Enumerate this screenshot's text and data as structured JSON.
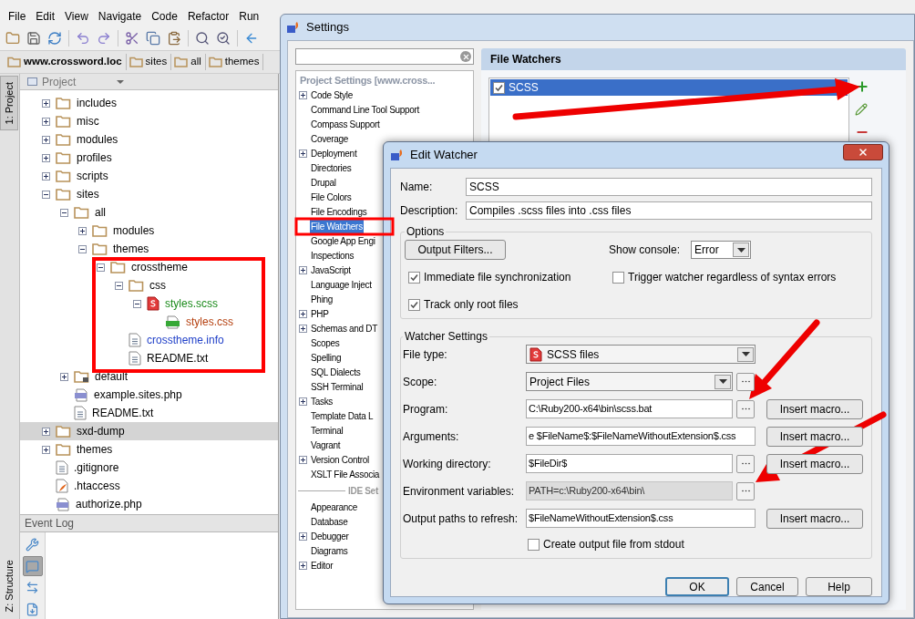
{
  "menu": [
    "File",
    "Edit",
    "View",
    "Navigate",
    "Code",
    "Refactor",
    "Run"
  ],
  "breadcrumb": [
    {
      "label": "www.crossword.loc",
      "kind": "root"
    },
    {
      "label": "sites",
      "kind": "folder"
    },
    {
      "label": "all",
      "kind": "folder"
    },
    {
      "label": "themes",
      "kind": "folder"
    }
  ],
  "side_tabs": {
    "top": [
      {
        "label": "1: Project",
        "selected": true
      }
    ],
    "bottom": [
      {
        "label": "Z: Structure",
        "selected": false
      }
    ]
  },
  "project_panel": {
    "title": "Project"
  },
  "tree": [
    {
      "label": "includes",
      "kind": "folder",
      "expanded": false,
      "selected": false
    },
    {
      "label": "misc",
      "kind": "folder",
      "expanded": false,
      "selected": false
    },
    {
      "label": "modules",
      "kind": "folder",
      "expanded": false,
      "selected": false
    },
    {
      "label": "profiles",
      "kind": "folder",
      "expanded": false,
      "selected": false
    },
    {
      "label": "scripts",
      "kind": "folder",
      "expanded": false,
      "selected": false
    },
    {
      "label": "sites",
      "kind": "folder",
      "expanded": true,
      "selected": false,
      "children": [
        {
          "label": "all",
          "kind": "folder",
          "expanded": true,
          "selected": false,
          "children": [
            {
              "label": "modules",
              "kind": "folder",
              "expanded": false,
              "selected": false
            },
            {
              "label": "themes",
              "kind": "folder",
              "expanded": true,
              "selected": false,
              "children": [
                {
                  "label": "crosstheme",
                  "kind": "folder",
                  "expanded": true,
                  "selected": false,
                  "children": [
                    {
                      "label": "css",
                      "kind": "folder",
                      "expanded": true,
                      "selected": false,
                      "children": [
                        {
                          "label": "styles.scss",
                          "kind": "scss",
                          "expanded": true,
                          "selected": false,
                          "color": "#1a8a1a",
                          "children": [
                            {
                              "label": "styles.css",
                              "kind": "css",
                              "selected": false,
                              "color": "#b5400f"
                            }
                          ]
                        }
                      ]
                    },
                    {
                      "label": "crosstheme.info",
                      "kind": "text",
                      "selected": false,
                      "color": "#1f3fc8"
                    },
                    {
                      "label": "README.txt",
                      "kind": "text",
                      "selected": false
                    }
                  ]
                }
              ]
            }
          ]
        },
        {
          "label": "default",
          "kind": "locked_folder",
          "expanded": false,
          "selected": false
        },
        {
          "label": "example.sites.php",
          "kind": "php",
          "selected": false
        },
        {
          "label": "README.txt",
          "kind": "text",
          "selected": false
        }
      ]
    },
    {
      "label": "sxd-dump",
      "kind": "folder",
      "expanded": false,
      "selected": true
    },
    {
      "label": "themes",
      "kind": "folder",
      "expanded": false,
      "selected": false
    },
    {
      "label": ".gitignore",
      "kind": "text",
      "selected": false
    },
    {
      "label": ".htaccess",
      "kind": "htaccess",
      "selected": false
    },
    {
      "label": "authorize.php",
      "kind": "php",
      "selected": false
    }
  ],
  "event_log": {
    "title": "Event Log",
    "tools": [
      {
        "selected": false
      },
      {
        "selected": true
      },
      {
        "selected": false
      },
      {
        "selected": false
      }
    ]
  },
  "settings": {
    "title": "Settings",
    "sections": [
      {
        "title": "Project Settings [www.cross...",
        "items": [
          {
            "label": "Code Style",
            "expandable": true,
            "selected": false
          },
          {
            "label": "Command Line Tool Support",
            "expandable": false,
            "selected": false
          },
          {
            "label": "Compass Support",
            "expandable": false,
            "selected": false
          },
          {
            "label": "Coverage",
            "expandable": false,
            "selected": false
          },
          {
            "label": "Deployment",
            "expandable": true,
            "selected": false
          },
          {
            "label": "Directories",
            "expandable": false,
            "selected": false
          },
          {
            "label": "Drupal",
            "expandable": false,
            "selected": false
          },
          {
            "label": "File Colors",
            "expandable": false,
            "selected": false
          },
          {
            "label": "File Encodings",
            "expandable": false,
            "selected": false
          },
          {
            "label": "File Watchers",
            "expandable": false,
            "selected": true
          },
          {
            "label": "Google App Engi",
            "expandable": false,
            "selected": false
          },
          {
            "label": "Inspections",
            "expandable": false,
            "selected": false
          },
          {
            "label": "JavaScript",
            "expandable": true,
            "selected": false
          },
          {
            "label": "Language Inject",
            "expandable": false,
            "selected": false
          },
          {
            "label": "Phing",
            "expandable": false,
            "selected": false
          },
          {
            "label": "PHP",
            "expandable": true,
            "selected": false
          },
          {
            "label": "Schemas and DT",
            "expandable": true,
            "selected": false
          },
          {
            "label": "Scopes",
            "expandable": false,
            "selected": false
          },
          {
            "label": "Spelling",
            "expandable": false,
            "selected": false
          },
          {
            "label": "SQL Dialects",
            "expandable": false,
            "selected": false
          },
          {
            "label": "SSH Terminal",
            "expandable": false,
            "selected": false
          },
          {
            "label": "Tasks",
            "expandable": true,
            "selected": false
          },
          {
            "label": "Template Data L",
            "expandable": false,
            "selected": false
          },
          {
            "label": "Terminal",
            "expandable": false,
            "selected": false
          },
          {
            "label": "Vagrant",
            "expandable": false,
            "selected": false
          },
          {
            "label": "Version Control",
            "expandable": true,
            "selected": false
          },
          {
            "label": "XSLT File Associa",
            "expandable": false,
            "selected": false
          }
        ]
      },
      {
        "title": "IDE Set",
        "items": [
          {
            "label": "Appearance",
            "expandable": false,
            "selected": false
          },
          {
            "label": "Database",
            "expandable": false,
            "selected": false
          },
          {
            "label": "Debugger",
            "expandable": true,
            "selected": false
          },
          {
            "label": "Diagrams",
            "expandable": false,
            "selected": false
          },
          {
            "label": "Editor",
            "expandable": true,
            "selected": false
          }
        ]
      }
    ],
    "panel_title": "File Watchers",
    "watchers": [
      {
        "name": "SCSS",
        "enabled": true,
        "selected": true
      }
    ]
  },
  "edit_watcher": {
    "title": "Edit Watcher",
    "name": {
      "label": "Name:",
      "value": "SCSS"
    },
    "description": {
      "label": "Description:",
      "value": "Compiles .scss files into .css files"
    },
    "options": {
      "title": "Options",
      "filters_button": "Output Filters...",
      "console_label": "Show console:",
      "console_value": "Error",
      "checks": [
        {
          "label": "Immediate file synchronization",
          "checked": true
        },
        {
          "label": "Trigger watcher regardless of syntax errors",
          "checked": false
        },
        {
          "label": "Track only root files",
          "checked": true
        }
      ]
    },
    "settings": {
      "title": "Watcher Settings",
      "rows": [
        {
          "kind": "filetype",
          "label": "File type:",
          "value": "SCSS files",
          "browse": false
        },
        {
          "kind": "dropdown",
          "label": "Scope:",
          "value": "Project Files",
          "browse": true
        },
        {
          "kind": "field",
          "label": "Program:",
          "value": "C:\\Ruby200-x64\\bin\\scss.bat",
          "browse": true,
          "readonly": false,
          "macro": "Insert macro..."
        },
        {
          "kind": "field",
          "label": "Arguments:",
          "value": "e $FileName$:$FileNameWithoutExtension$.css",
          "browse": false,
          "readonly": false,
          "macro": "Insert macro..."
        },
        {
          "kind": "field",
          "label": "Working directory:",
          "value": "$FileDir$",
          "browse": true,
          "readonly": false,
          "macro": "Insert macro..."
        },
        {
          "kind": "field",
          "label": "Environment variables:",
          "value": "PATH=c:\\Ruby200-x64\\bin\\",
          "browse": true,
          "readonly": true
        },
        {
          "kind": "field",
          "label": "Output paths to refresh:",
          "value": "$FileNameWithoutExtension$.css",
          "browse": false,
          "readonly": false,
          "macro": "Insert macro..."
        }
      ],
      "stdout": {
        "label": "Create output file from stdout",
        "checked": false
      }
    },
    "buttons": [
      {
        "label": "OK",
        "default": true
      },
      {
        "label": "Cancel",
        "default": false
      },
      {
        "label": "Help",
        "default": false
      }
    ]
  }
}
